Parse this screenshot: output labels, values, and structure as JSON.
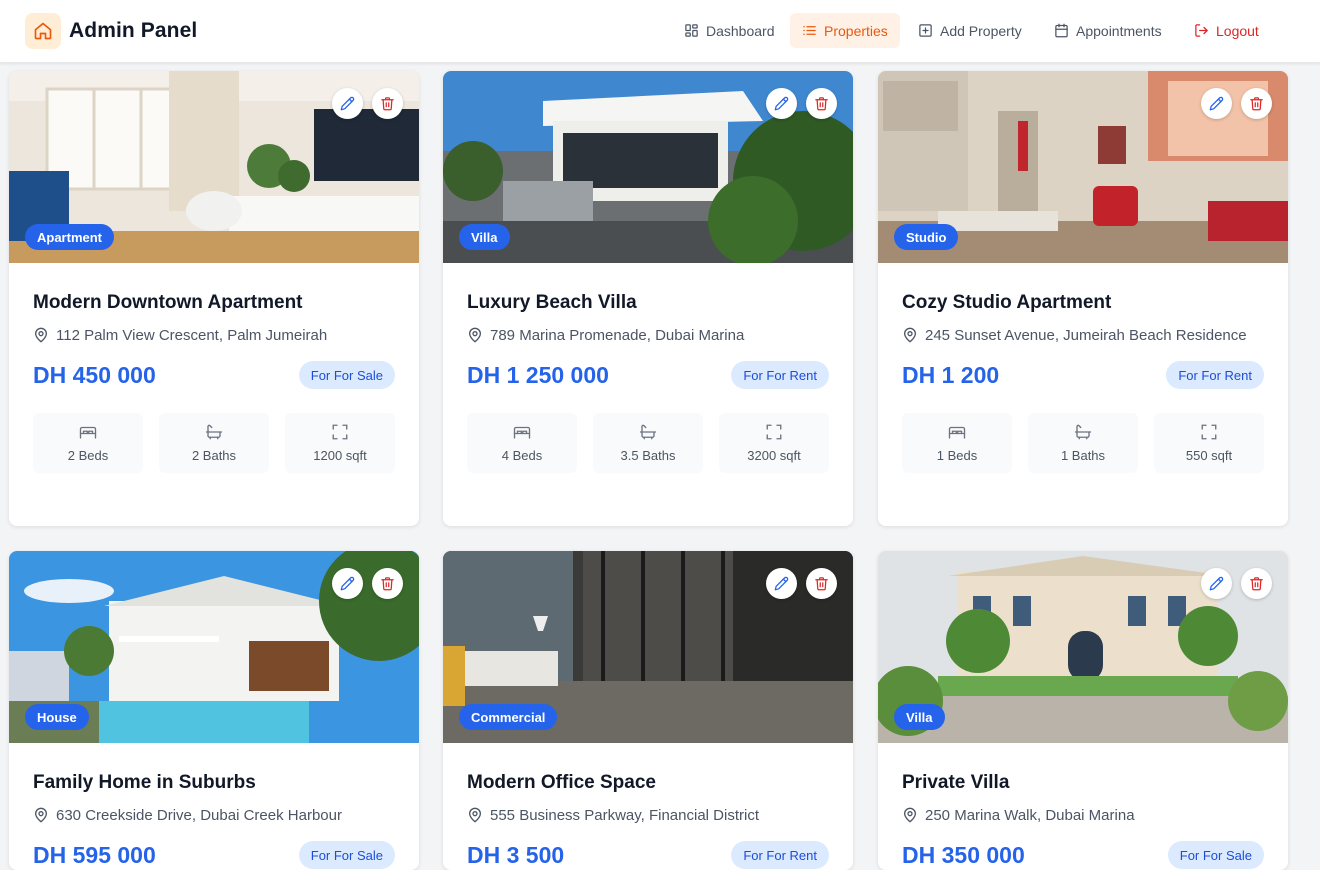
{
  "header": {
    "brand": "Admin Panel",
    "nav": [
      {
        "label": "Dashboard",
        "icon": "dashboard-icon"
      },
      {
        "label": "Properties",
        "icon": "list-icon",
        "active": true
      },
      {
        "label": "Add Property",
        "icon": "plus-square-icon"
      },
      {
        "label": "Appointments",
        "icon": "calendar-icon"
      },
      {
        "label": "Logout",
        "icon": "logout-icon"
      }
    ]
  },
  "colors": {
    "accent": "#2563eb",
    "brand": "#ea580c",
    "danger": "#dc2626",
    "status_bg": "#dbeafe"
  },
  "properties": [
    {
      "type": "Apartment",
      "title": "Modern Downtown Apartment",
      "address": "112 Palm View Crescent, Palm Jumeirah",
      "price": "DH 450 000",
      "status": "For For Sale",
      "beds": "2 Beds",
      "baths": "2 Baths",
      "area": "1200 sqft"
    },
    {
      "type": "Villa",
      "title": "Luxury Beach Villa",
      "address": "789 Marina Promenade, Dubai Marina",
      "price": "DH 1 250 000",
      "status": "For For Rent",
      "beds": "4 Beds",
      "baths": "3.5 Baths",
      "area": "3200 sqft"
    },
    {
      "type": "Studio",
      "title": "Cozy Studio Apartment",
      "address": "245 Sunset Avenue, Jumeirah Beach Residence",
      "price": "DH 1 200",
      "status": "For For Rent",
      "beds": "1 Beds",
      "baths": "1 Baths",
      "area": "550 sqft"
    },
    {
      "type": "House",
      "title": "Family Home in Suburbs",
      "address": "630 Creekside Drive, Dubai Creek Harbour",
      "price": "DH 595 000",
      "status": "For For Sale"
    },
    {
      "type": "Commercial",
      "title": "Modern Office Space",
      "address": "555 Business Parkway, Financial District",
      "price": "DH 3 500",
      "status": "For For Rent"
    },
    {
      "type": "Villa",
      "title": "Private Villa",
      "address": "250 Marina Walk, Dubai Marina",
      "price": "DH 350 000",
      "status": "For For Sale"
    }
  ]
}
